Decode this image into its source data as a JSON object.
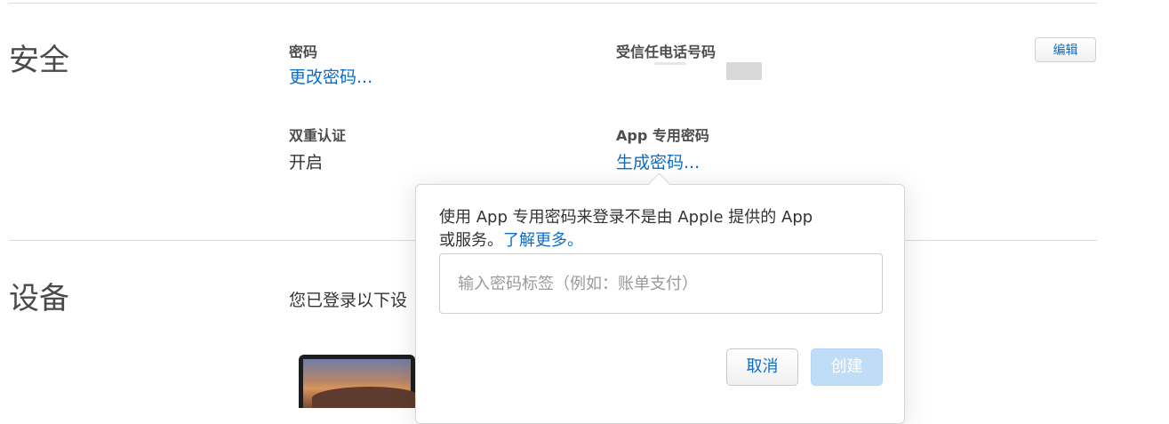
{
  "security": {
    "title": "安全",
    "edit_label": "编辑",
    "password": {
      "label": "密码",
      "action": "更改密码..."
    },
    "trusted_phone": {
      "label": "受信任电话号码"
    },
    "two_factor": {
      "label": "双重认证",
      "value": "开启"
    },
    "app_password": {
      "label": "App 专用密码",
      "action": "生成密码..."
    }
  },
  "devices": {
    "title": "设备",
    "text": "您已登录以下设"
  },
  "popover": {
    "description_line1": "使用 App 专用密码来登录不是由 Apple 提供的 App",
    "description_line2": "或服务。",
    "learn_more": "了解更多。",
    "input_placeholder": "输入密码标签（例如：账单支付）",
    "cancel_label": "取消",
    "create_label": "创建"
  },
  "colors": {
    "link": "#0a6ec8",
    "create_disabled": "#bfddf7"
  }
}
